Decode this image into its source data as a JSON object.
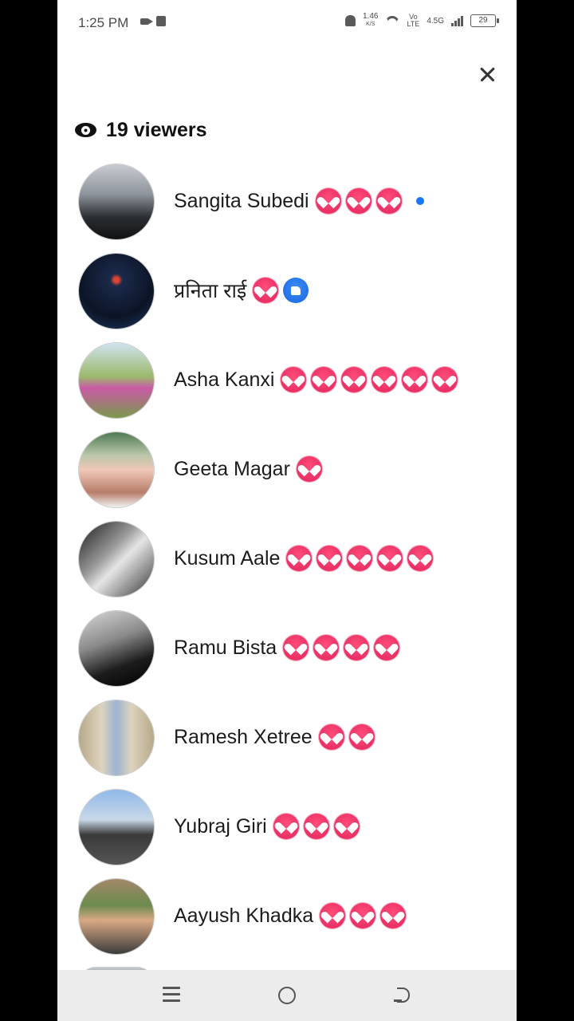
{
  "status_bar": {
    "time": "1:25 PM",
    "net_speed": "1.46",
    "net_unit": "K/S",
    "volte_top": "Vo",
    "volte_bottom": "LTE",
    "network_type": "4.5G",
    "battery": "29"
  },
  "viewers": {
    "count_label": "19 viewers",
    "list": [
      {
        "name": "Sangita Subedi",
        "reactions": [
          "love",
          "love",
          "love"
        ],
        "active": true
      },
      {
        "name": "प्रनिता राई",
        "reactions": [
          "love",
          "like"
        ],
        "active": false
      },
      {
        "name": "Asha Kanxi",
        "reactions": [
          "love",
          "love",
          "love",
          "love",
          "love",
          "love"
        ],
        "active": false
      },
      {
        "name": "Geeta Magar",
        "reactions": [
          "love"
        ],
        "active": false
      },
      {
        "name": "Kusum Aale",
        "reactions": [
          "love",
          "love",
          "love",
          "love",
          "love"
        ],
        "active": false
      },
      {
        "name": "Ramu Bista",
        "reactions": [
          "love",
          "love",
          "love",
          "love"
        ],
        "active": false
      },
      {
        "name": "Ramesh Xetree",
        "reactions": [
          "love",
          "love"
        ],
        "active": false
      },
      {
        "name": "Yubraj Giri",
        "reactions": [
          "love",
          "love",
          "love"
        ],
        "active": false
      },
      {
        "name": "Aayush Khadka",
        "reactions": [
          "love",
          "love",
          "love"
        ],
        "active": false
      }
    ]
  },
  "icons": {
    "close": "close-icon",
    "eye": "eye-icon",
    "love": "heart-reaction-icon",
    "like": "like-reaction-icon"
  },
  "colors": {
    "love": "#e0245e",
    "like": "#1877f2",
    "active_dot": "#1877f2"
  }
}
